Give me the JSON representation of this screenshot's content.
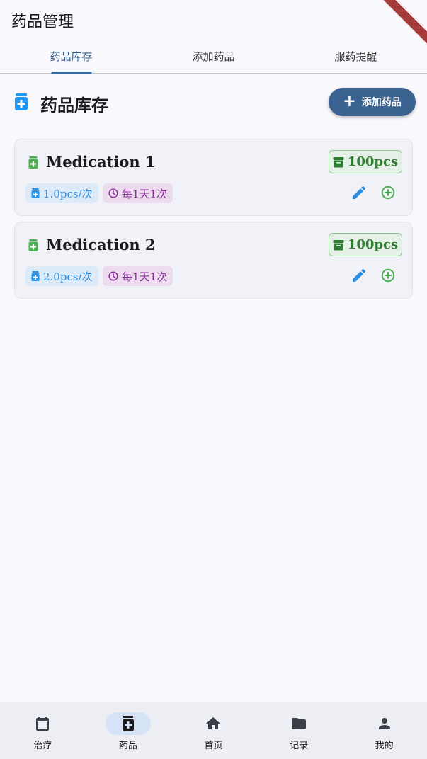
{
  "appbar": {
    "title": "药品管理"
  },
  "tabs": [
    {
      "label": "药品库存",
      "active": true
    },
    {
      "label": "添加药品",
      "active": false
    },
    {
      "label": "服药提醒",
      "active": false
    }
  ],
  "section": {
    "title": "药品库存",
    "add_button_label": "添加药品",
    "icon": "medication-icon"
  },
  "medications": [
    {
      "name": "Medication 1",
      "stock": "100pcs",
      "dose": "1.0pcs/次",
      "frequency": "每1天1次"
    },
    {
      "name": "Medication 2",
      "stock": "100pcs",
      "dose": "2.0pcs/次",
      "frequency": "每1天1次"
    }
  ],
  "bottom_nav": [
    {
      "label": "治疗",
      "icon": "calendar-icon",
      "active": false
    },
    {
      "label": "药品",
      "icon": "medication-icon",
      "active": true
    },
    {
      "label": "首页",
      "icon": "home-icon",
      "active": false
    },
    {
      "label": "记录",
      "icon": "folder-icon",
      "active": false
    },
    {
      "label": "我的",
      "icon": "person-icon",
      "active": false
    }
  ],
  "colors": {
    "primary": "#3a6391",
    "stock_green": "#2e7d32",
    "dose_blue": "#2e8ee0",
    "freq_purple": "#8e2fa0",
    "pill_green": "#4caf50"
  }
}
